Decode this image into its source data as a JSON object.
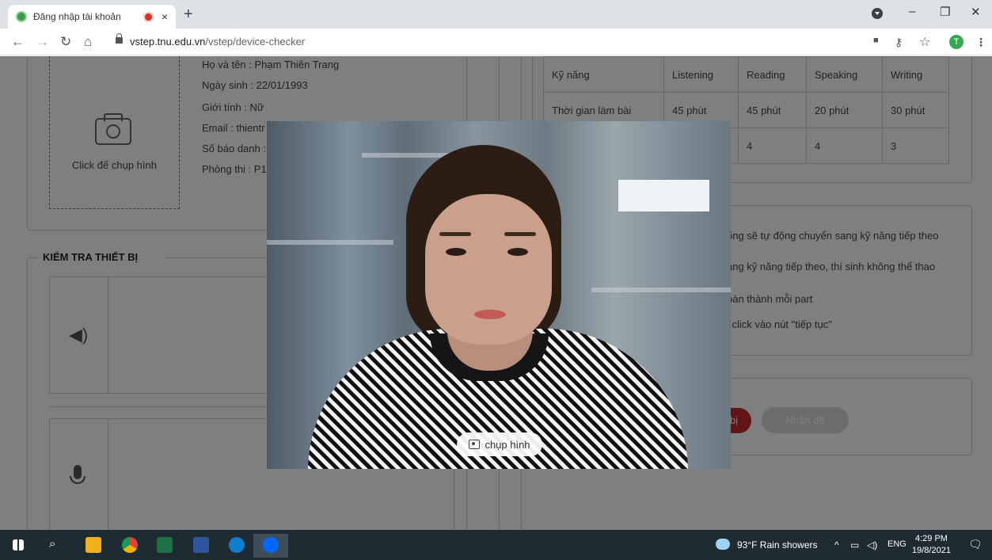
{
  "browser": {
    "tab_title": "Đăng nhập tài khoản",
    "tab_close": "×",
    "new_tab": "+",
    "url_host": "vstep.tnu.edu.vn",
    "url_path": "/vstep/device-checker",
    "profile_initial": "T",
    "window_controls": {
      "minimize": "–",
      "maximize": "❐",
      "close": "✕"
    }
  },
  "candidate": {
    "photo_label": "Click để chụp hình",
    "name": "Họ và tên : Phạm Thiên Trang",
    "dob": "Ngày sinh : 22/01/1993",
    "gender": "Giới tính : Nữ",
    "email": "Email : thientr",
    "sbd": "Số báo danh :",
    "room": "Phòng thi : P1"
  },
  "device_check": {
    "title": "KIỂM TRA THIẾT BỊ"
  },
  "skills_table": {
    "headers": [
      "Kỹ năng",
      "Listening",
      "Reading",
      "Speaking",
      "Writing"
    ],
    "rows": [
      [
        "Thời gian làm bài",
        "45 phút",
        "45 phút",
        "20 phút",
        "30 phút"
      ],
      [
        "",
        "",
        "4",
        "4",
        "3"
      ]
    ]
  },
  "rules": [
    "ống sẽ tự động chuyển sang kỹ năng tiếp theo",
    "ang kỹ năng tiếp theo, thí sinh không thể thao",
    "oàn thành mỗi part",
    "i click vào nút \"tiếp tục\""
  ],
  "buttons": {
    "ready_partial": "bị",
    "receive_exam": "Nhận đề"
  },
  "camera_modal": {
    "capture_label": "chụp hình"
  },
  "taskbar": {
    "weather": "93°F  Rain showers",
    "lang": "ENG",
    "time": "4:29 PM",
    "date": "19/8/2021"
  }
}
